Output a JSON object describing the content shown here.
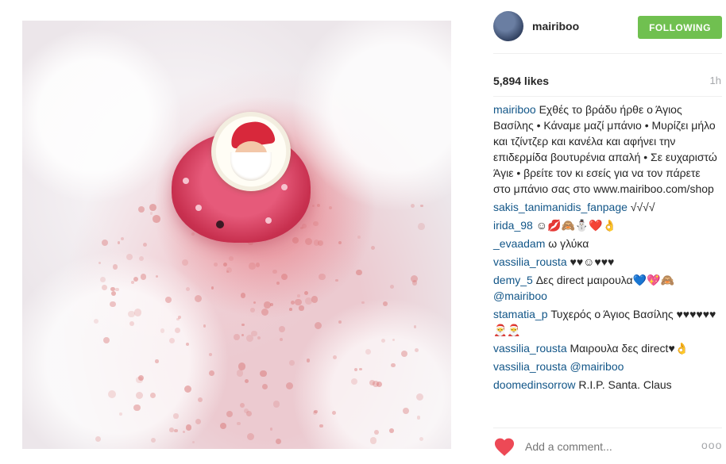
{
  "post": {
    "username": "mairiboo",
    "follow_label": "FOLLOWING",
    "likes": "5,894 likes",
    "time": "1h"
  },
  "caption": {
    "user": "mairiboo",
    "text": "Εχθές το βράδυ ήρθε ο Άγιος Βασίλης • Κάναμε μαζί μπάνιο • Μυρίζει μήλο και τζίντζερ και κανέλα και αφήνει την επιδερμίδα βουτυρένια απαλή • Σε ευχαριστώ Άγιε • βρείτε τον κι εσείς για να τον πάρετε στο μπάνιο σας στο www.mairiboo.com/shop"
  },
  "comments": [
    {
      "user": "sakis_tanimanidis_fanpage",
      "text": "√√√√",
      "mention": ""
    },
    {
      "user": "irida_98",
      "text": "☺︎💋🙈⛄❤️👌",
      "mention": ""
    },
    {
      "user": "_evaadam",
      "text": "ω γλύκα",
      "mention": ""
    },
    {
      "user": "vassilia_rousta",
      "text": "♥♥☺♥♥♥",
      "mention": ""
    },
    {
      "user": "demy_5",
      "text": "Δες direct μαιρουλα💙💖🙈",
      "mention": "@mairiboo"
    },
    {
      "user": "stamatia_p",
      "text": "Τυχερός ο Άγιος Βασίλης ♥♥♥♥♥♥🎅🎅",
      "mention": ""
    },
    {
      "user": "vassilia_rousta",
      "text": "Μαιρουλα δες direct♥👌",
      "mention": ""
    },
    {
      "user": "vassilia_rousta",
      "text": "",
      "mention": "@mairiboo"
    },
    {
      "user": "doomedinsorrow",
      "text": "R.I.P. Santa. Claus",
      "mention": ""
    }
  ],
  "footer": {
    "add_comment_placeholder": "Add a comment...",
    "more_label": "ooo"
  },
  "colors": {
    "follow_button": "#70c050",
    "username": "#125688",
    "heart": "#ed4956"
  }
}
